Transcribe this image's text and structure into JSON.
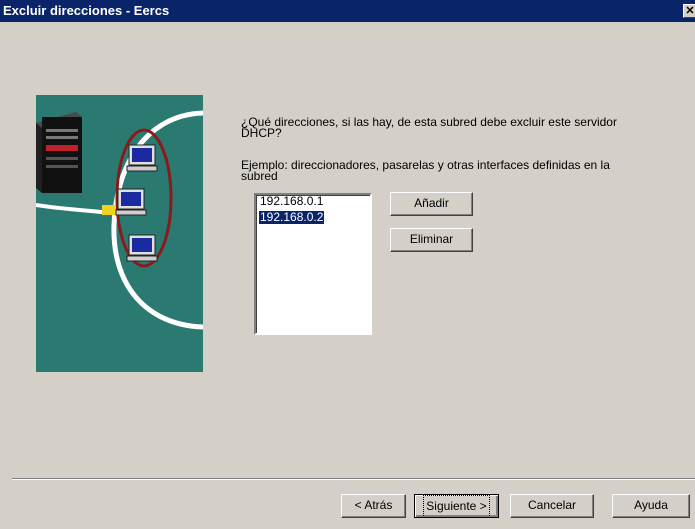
{
  "window": {
    "title": "Excluir direcciones - Eercs",
    "close_glyph": "✕"
  },
  "content": {
    "question": "¿Qué direcciones, si las hay, de esta subred debe excluir este servidor DHCP?",
    "example": "Ejemplo: direccionadores, pasarelas y otras interfaces definidas en la subred"
  },
  "address_list": {
    "items": [
      {
        "label": "192.168.0.1",
        "selected": false
      },
      {
        "label": "192.168.0.2",
        "selected": true
      }
    ]
  },
  "buttons": {
    "add": "Añadir",
    "remove": "Eliminar",
    "back": "< Atrás",
    "next": "Siguiente >",
    "cancel": "Cancelar",
    "help": "Ayuda"
  },
  "illustration": {
    "icons": [
      "server-icon",
      "network-cable-icon",
      "workstation-icon",
      "workstation-icon",
      "workstation-icon"
    ],
    "colors": {
      "background": "#2a7a72",
      "ring": "#8b1a1a",
      "cable": "#ffffff",
      "connector": "#f0d020"
    }
  }
}
